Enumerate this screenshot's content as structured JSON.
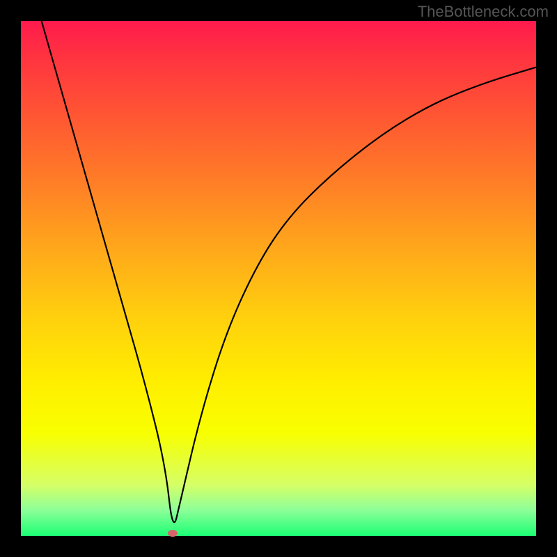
{
  "watermark": "TheBottleneck.com",
  "chart_data": {
    "type": "line",
    "title": "",
    "xlabel": "",
    "ylabel": "",
    "xlim": [
      0,
      100
    ],
    "ylim": [
      0,
      100
    ],
    "series": [
      {
        "name": "bottleneck-curve",
        "x": [
          4,
          8,
          12,
          16,
          20,
          24,
          28,
          29.5,
          31,
          35,
          40,
          46,
          52,
          60,
          70,
          80,
          90,
          100
        ],
        "values": [
          100,
          86,
          72,
          58,
          44,
          30,
          14,
          0.5,
          7,
          24,
          40,
          53,
          62,
          70,
          78,
          84,
          88,
          91
        ]
      }
    ],
    "marker": {
      "x": 29.5,
      "y": 0.5
    }
  },
  "colors": {
    "frame": "#000000",
    "curve": "#000000",
    "marker": "#d9636b",
    "gradient_top": "#ff1a4d",
    "gradient_bottom": "#1aff73",
    "watermark": "#555555"
  }
}
